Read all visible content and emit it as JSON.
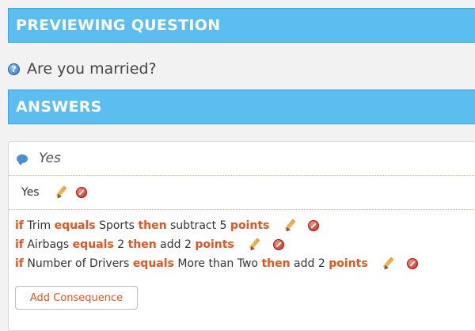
{
  "header": {
    "title": "PREVIEWING QUESTION"
  },
  "question": {
    "icon": "help-icon",
    "text": "Are you married?"
  },
  "answers_section": {
    "title": "ANSWERS"
  },
  "answer": {
    "icon": "speech-bubble-icon",
    "title": "Yes",
    "value_label": "Yes"
  },
  "rules": [
    {
      "kw_if": "if",
      "field": "Trim",
      "kw_equals": "equals",
      "value": "Sports",
      "kw_then": "then",
      "action": "subtract",
      "amount": "5",
      "kw_points": "points"
    },
    {
      "kw_if": "if",
      "field": "Airbags",
      "kw_equals": "equals",
      "value": "2",
      "kw_then": "then",
      "action": "add",
      "amount": "2",
      "kw_points": "points"
    },
    {
      "kw_if": "if",
      "field": "Number of Drivers",
      "kw_equals": "equals",
      "value": "More than Two",
      "kw_then": "then",
      "action": "add",
      "amount": "2",
      "kw_points": "points"
    }
  ],
  "buttons": {
    "add_consequence": "Add Consequence"
  },
  "colors": {
    "banner": "#5cbef0",
    "keyword": "#e8541b",
    "delete": "#c9291c"
  }
}
